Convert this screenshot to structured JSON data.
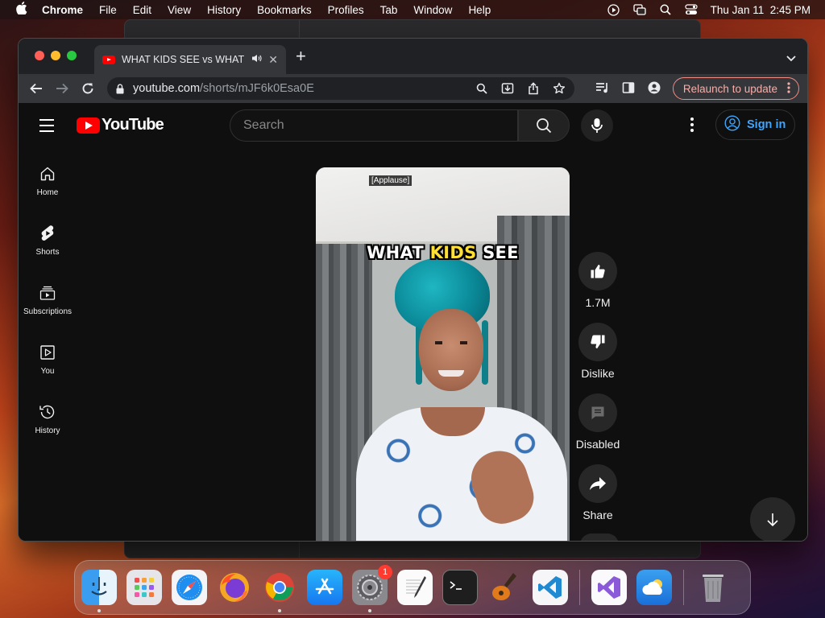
{
  "menubar": {
    "app": "Chrome",
    "items": [
      "File",
      "Edit",
      "View",
      "History",
      "Bookmarks",
      "Profiles",
      "Tab",
      "Window",
      "Help"
    ],
    "datetime": "Thu Jan 11  2:45 PM"
  },
  "browser": {
    "tab_title": "WHAT KIDS SEE vs WHAT",
    "url_host": "youtube.com",
    "url_path": "/shorts/mJF6k0Esa0E",
    "relaunch_label": "Relaunch to update"
  },
  "youtube": {
    "logo_text": "YouTube",
    "search_placeholder": "Search",
    "signin_label": "Sign in",
    "sidebar": [
      {
        "label": "Home",
        "icon": "home-icon"
      },
      {
        "label": "Shorts",
        "icon": "shorts-icon"
      },
      {
        "label": "Subscriptions",
        "icon": "subscriptions-icon"
      },
      {
        "label": "You",
        "icon": "you-icon"
      },
      {
        "label": "History",
        "icon": "history-icon"
      }
    ],
    "video": {
      "caption": "[Applause]",
      "overlay_pre": "WHAT ",
      "overlay_hl": "KIDS",
      "overlay_post": " SEE",
      "highlight_color": "#ffe033"
    },
    "actions": {
      "like_count": "1.7M",
      "dislike_label": "Dislike",
      "comments_label": "Disabled",
      "share_label": "Share"
    }
  },
  "dock": {
    "apps": [
      "Finder",
      "Launchpad",
      "Safari",
      "Firefox",
      "Chrome",
      "App Store",
      "System Settings",
      "TextEdit",
      "Terminal",
      "GarageBand",
      "Visual Studio Code",
      "Visual Studio",
      "Weather",
      "Trash"
    ],
    "settings_badge": "1"
  }
}
